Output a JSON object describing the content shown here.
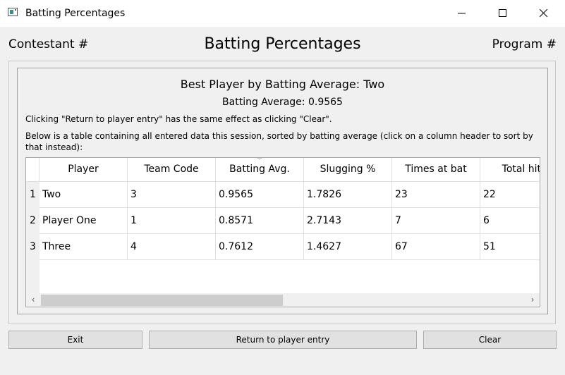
{
  "window": {
    "title": "Batting Percentages"
  },
  "header": {
    "left": "Contestant #",
    "center": "Batting Percentages",
    "right": "Program #"
  },
  "summary": {
    "best_player": "Best Player by Batting Average: Two",
    "batting_average": "Batting Average: 0.9565",
    "info_return": "Clicking \"Return to player entry\" has the same effect as clicking \"Clear\".",
    "info_table": "Below is a table containing all entered data this session, sorted by batting average (click on a column header to sort by that instead):"
  },
  "table": {
    "columns": [
      "Player",
      "Team Code",
      "Batting Avg.",
      "Slugging %",
      "Times at bat",
      "Total hits"
    ],
    "sorted_column": "Batting Avg.",
    "row_numbers": [
      "1",
      "2",
      "3"
    ],
    "rows": [
      [
        "Two",
        "3",
        "0.9565",
        "1.7826",
        "23",
        "22"
      ],
      [
        "Player One",
        "1",
        "0.8571",
        "2.7143",
        "7",
        "6"
      ],
      [
        "Three",
        "4",
        "0.7612",
        "1.4627",
        "67",
        "51"
      ]
    ]
  },
  "buttons": {
    "exit": "Exit",
    "return": "Return to player entry",
    "clear": "Clear"
  },
  "icons": {
    "app": "app-window-icon",
    "minimize": "minimize-icon",
    "maximize": "maximize-icon",
    "close": "close-icon",
    "sort": "sort-descending-icon",
    "scroll_left": "chevron-left-icon",
    "scroll_right": "chevron-right-icon"
  }
}
